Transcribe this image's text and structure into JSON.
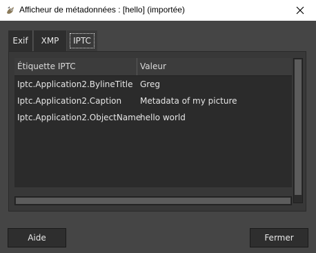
{
  "window": {
    "title": "Afficheur de métadonnées : [hello] (importée)",
    "icon": "gimp-wilber-icon",
    "close_icon": "close-icon"
  },
  "tabs": [
    {
      "label": "Exif",
      "selected": false
    },
    {
      "label": "XMP",
      "selected": false
    },
    {
      "label": "IPTC",
      "selected": true
    }
  ],
  "table": {
    "columns": [
      "Étiquette IPTC",
      "Valeur"
    ],
    "rows": [
      {
        "tag": "Iptc.Application2.BylineTitle",
        "value": "Greg"
      },
      {
        "tag": "Iptc.Application2.Caption",
        "value": "Metadata of my picture"
      },
      {
        "tag": "Iptc.Application2.ObjectName",
        "value": "hello world"
      }
    ]
  },
  "buttons": {
    "help": "Aide",
    "close": "Fermer"
  }
}
